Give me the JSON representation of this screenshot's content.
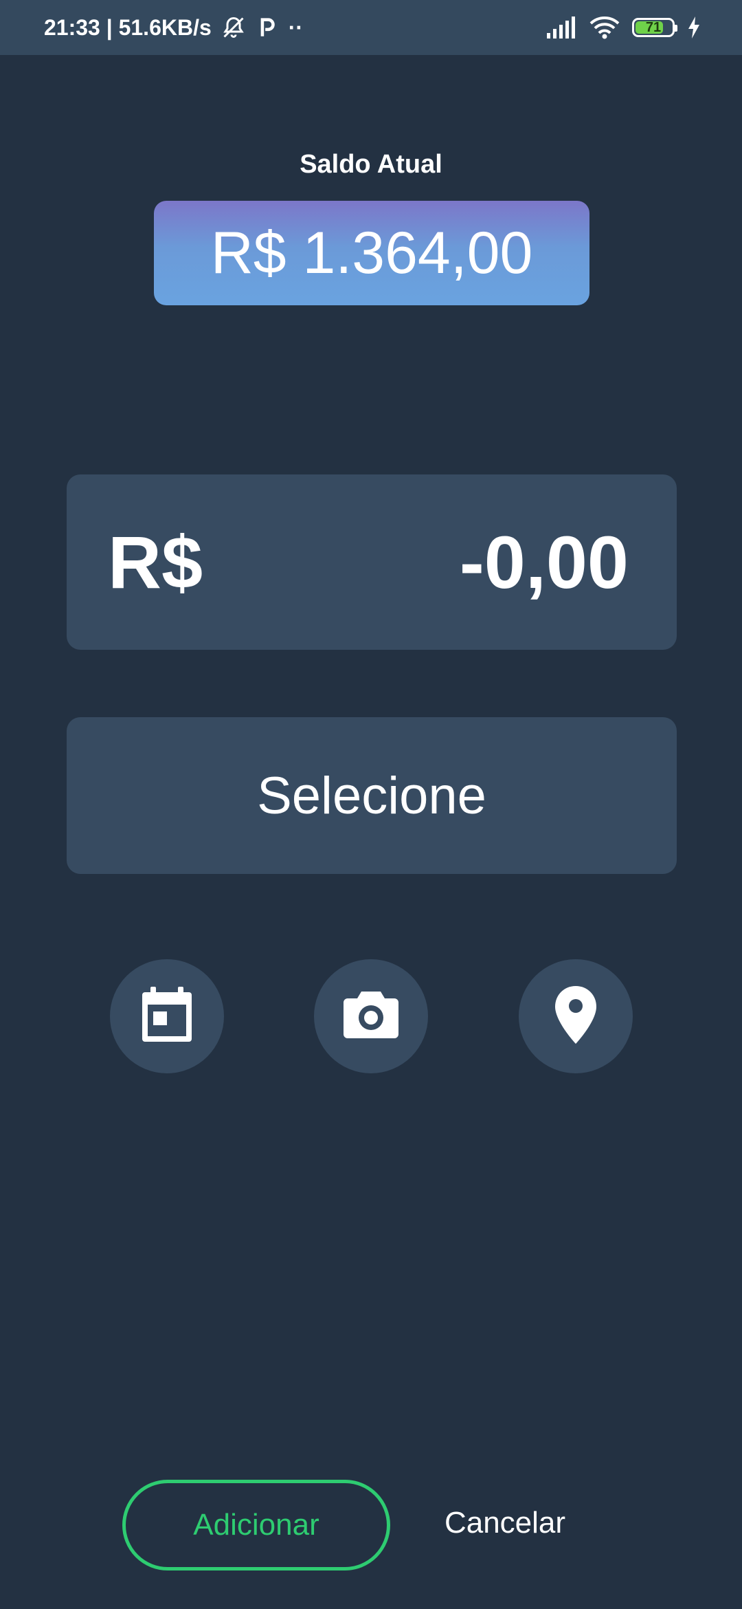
{
  "status_bar": {
    "time_speed": "21:33 | 51.6KB/s",
    "extra_indicator": "··",
    "battery_level": "71",
    "icons": [
      "mute-notification-icon",
      "parking-icon",
      "signal-icon",
      "wifi-icon",
      "battery-icon",
      "charging-icon"
    ]
  },
  "balance": {
    "label": "Saldo Atual",
    "value": "R$ 1.364,00"
  },
  "amount": {
    "currency": "R$",
    "value": "-0,00"
  },
  "category": {
    "placeholder": "Selecione"
  },
  "actions": {
    "icons": [
      "calendar-icon",
      "camera-icon",
      "location-pin-icon"
    ]
  },
  "buttons": {
    "add_label": "Adicionar",
    "cancel_label": "Cancelar"
  },
  "colors": {
    "background": "#233142",
    "card": "#374b61",
    "status_bar": "#34495e",
    "accent_green": "#2ecc71",
    "balance_gradient_top": "#7c77c9",
    "balance_gradient_bottom": "#6aa3e0"
  }
}
